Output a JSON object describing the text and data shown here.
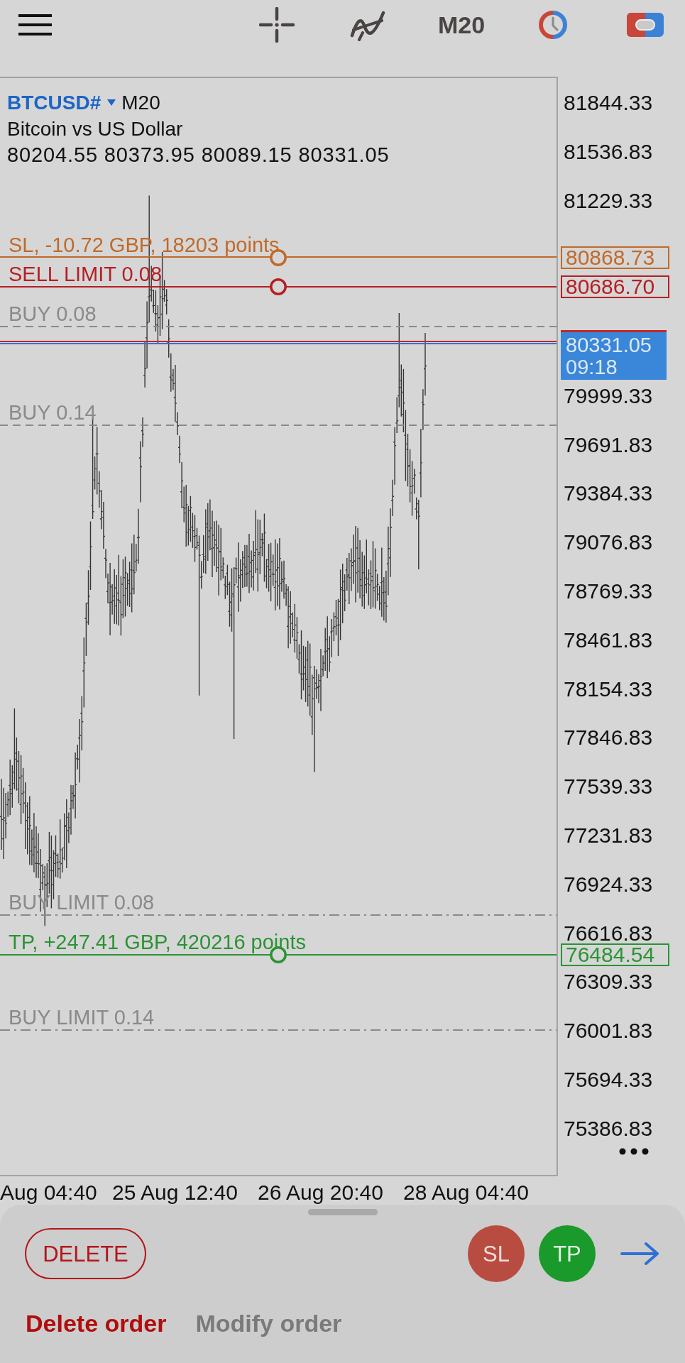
{
  "toolbar": {
    "timeframe": "M20"
  },
  "chart": {
    "symbol": "BTCUSD#",
    "timeframe": "M20",
    "description": "Bitcoin vs US Dollar",
    "ohlc": "80204.55 80373.95 80089.15 80331.05",
    "order_lines": [
      {
        "kind": "adjustable",
        "label": "SL, -10.72 GBP, 18203 points",
        "price": "80868.73",
        "color": "#c06a2c"
      },
      {
        "kind": "adjustable",
        "label": "SELL LIMIT 0.08",
        "price": "80686.70",
        "color": "#b51f24"
      },
      {
        "kind": "position",
        "label": "BUY 0.08",
        "color": "#8a8a8a"
      },
      {
        "kind": "position",
        "label": "BUY 0.14",
        "color": "#8a8a8a"
      },
      {
        "kind": "pending",
        "label": "BUY LIMIT 0.08",
        "color": "#8a8a8a"
      },
      {
        "kind": "adjustable",
        "label": "TP, +247.41 GBP, 420216 points",
        "price": "76484.54",
        "color": "#2b9334"
      },
      {
        "kind": "pending",
        "label": "BUY LIMIT 0.14",
        "color": "#8a8a8a"
      }
    ],
    "current_price": {
      "price": "80331.05",
      "time": "09:18"
    },
    "price_axis": [
      "81844.33",
      "81536.83",
      "81229.33",
      "79999.33",
      "79691.83",
      "79384.33",
      "79076.83",
      "78769.33",
      "78461.83",
      "78154.33",
      "77846.83",
      "77539.33",
      "77231.83",
      "76924.33",
      "76616.83",
      "76309.33",
      "76001.83",
      "75694.33",
      "75386.83"
    ],
    "time_axis": [
      "Aug 04:40",
      "25 Aug 12:40",
      "26 Aug 20:40",
      "28 Aug 04:40"
    ]
  },
  "actions": {
    "delete": "DELETE",
    "sl": "SL",
    "tp": "TP"
  },
  "tabs": [
    {
      "label": "Delete order",
      "selected": true
    },
    {
      "label": "Modify order",
      "selected": false
    }
  ]
}
